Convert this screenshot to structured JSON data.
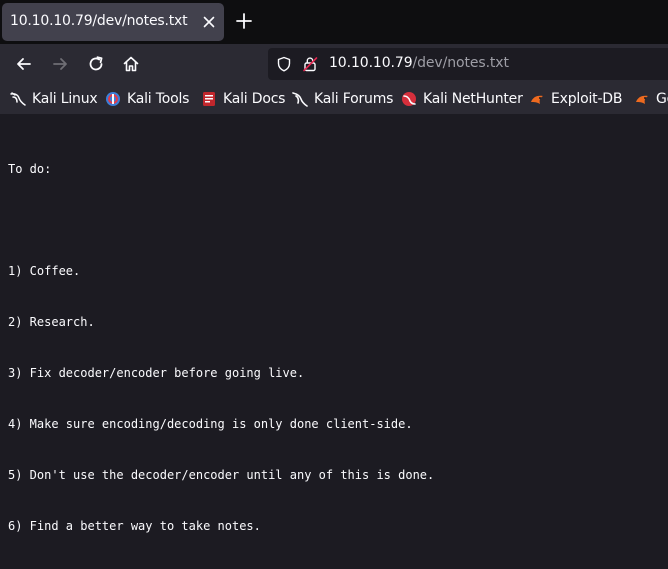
{
  "tab": {
    "title": "10.10.10.79/dev/notes.txt"
  },
  "address": {
    "host": "10.10.10.79",
    "path": "/dev/notes.txt"
  },
  "bookmarks": [
    {
      "label": "Kali Linux",
      "icon": "kali-dragon-icon"
    },
    {
      "label": "Kali Tools",
      "icon": "kali-tools-icon"
    },
    {
      "label": "Kali Docs",
      "icon": "kali-docs-icon"
    },
    {
      "label": "Kali Forums",
      "icon": "kali-forums-icon"
    },
    {
      "label": "Kali NetHunter",
      "icon": "kali-nethunter-icon"
    },
    {
      "label": "Exploit-DB",
      "icon": "exploit-db-icon"
    },
    {
      "label": "Go",
      "icon": "google-hacking-db-icon"
    }
  ],
  "document": {
    "lines": [
      "To do:",
      "",
      "1) Coffee.",
      "2) Research.",
      "3) Fix decoder/encoder before going live.",
      "4) Make sure encoding/decoding is only done client-side.",
      "5) Don't use the decoder/encoder until any of this is done.",
      "6) Find a better way to take notes."
    ]
  },
  "colors": {
    "tabbar_bg": "#0e0e10",
    "toolbar_bg": "#2b2a33",
    "page_bg": "#1c1b22",
    "text": "#fbfbfe",
    "url_path": "#9e9ea6"
  }
}
